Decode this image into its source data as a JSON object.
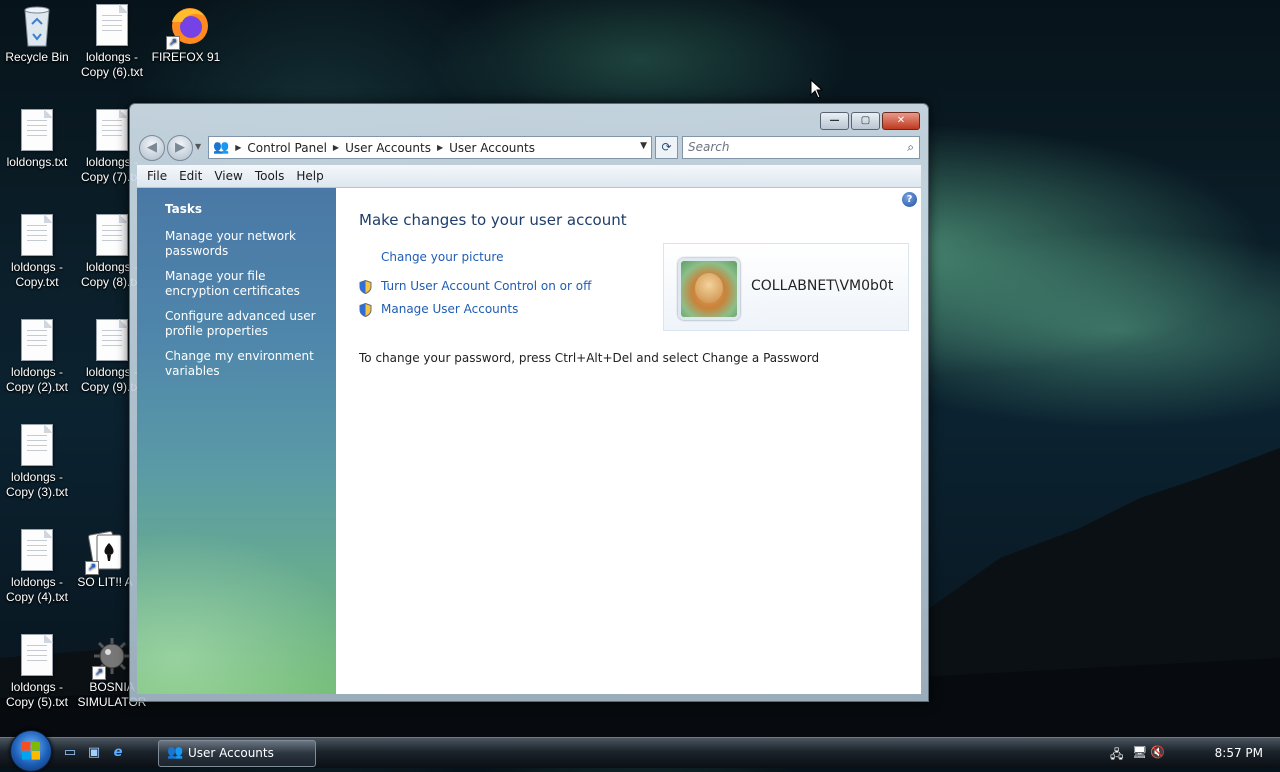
{
  "desktop": {
    "icons": [
      {
        "label": "Recycle Bin",
        "icon": "recycle-bin-icon"
      },
      {
        "label": "loldongs - Copy (6).txt",
        "icon": "text-file-icon"
      },
      {
        "label": "FIREFOX 91",
        "icon": "firefox-icon"
      },
      {
        "label": "loldongs.txt",
        "icon": "text-file-icon"
      },
      {
        "label": "loldongs - Copy (7).txt",
        "icon": "text-file-icon"
      },
      {
        "label": "loldongs - Copy.txt",
        "icon": "text-file-icon"
      },
      {
        "label": "loldongs - Copy (8).txt",
        "icon": "text-file-icon"
      },
      {
        "label": "loldongs - Copy (2).txt",
        "icon": "text-file-icon"
      },
      {
        "label": "loldongs - Copy (9).txt",
        "icon": "text-file-icon"
      },
      {
        "label": "loldongs - Copy (3).txt",
        "icon": "text-file-icon"
      },
      {
        "label": "loldongs - Copy (4).txt",
        "icon": "text-file-icon"
      },
      {
        "label": "SO LIT!! A",
        "icon": "solitaire-icon"
      },
      {
        "label": "loldongs - Copy (5).txt",
        "icon": "text-file-icon"
      },
      {
        "label": "BOSNIA SIMULATOR",
        "icon": "mine-icon"
      }
    ]
  },
  "window": {
    "address": {
      "crumbs": [
        "Control Panel",
        "User Accounts",
        "User Accounts"
      ]
    },
    "search": {
      "placeholder": "Search"
    },
    "menu": [
      "File",
      "Edit",
      "View",
      "Tools",
      "Help"
    ],
    "sidebar": {
      "title": "Tasks",
      "links": [
        "Manage your network passwords",
        "Manage your file encryption certificates",
        "Configure advanced user profile properties",
        "Change my environment variables"
      ]
    },
    "main": {
      "heading": "Make changes to your user account",
      "links": [
        {
          "text": "Change your picture",
          "shield": false
        },
        {
          "text": "Turn User Account Control on or off",
          "shield": true
        },
        {
          "text": "Manage User Accounts",
          "shield": true
        }
      ],
      "note": "To change your password, press Ctrl+Alt+Del and select Change a Password",
      "user": {
        "name": "COLLABNET\\VM0b0t"
      }
    }
  },
  "taskbar": {
    "task_label": "User Accounts",
    "clock": "8:57 PM"
  },
  "colors": {
    "link": "#1f5db5",
    "heading": "#1e3d6b"
  }
}
